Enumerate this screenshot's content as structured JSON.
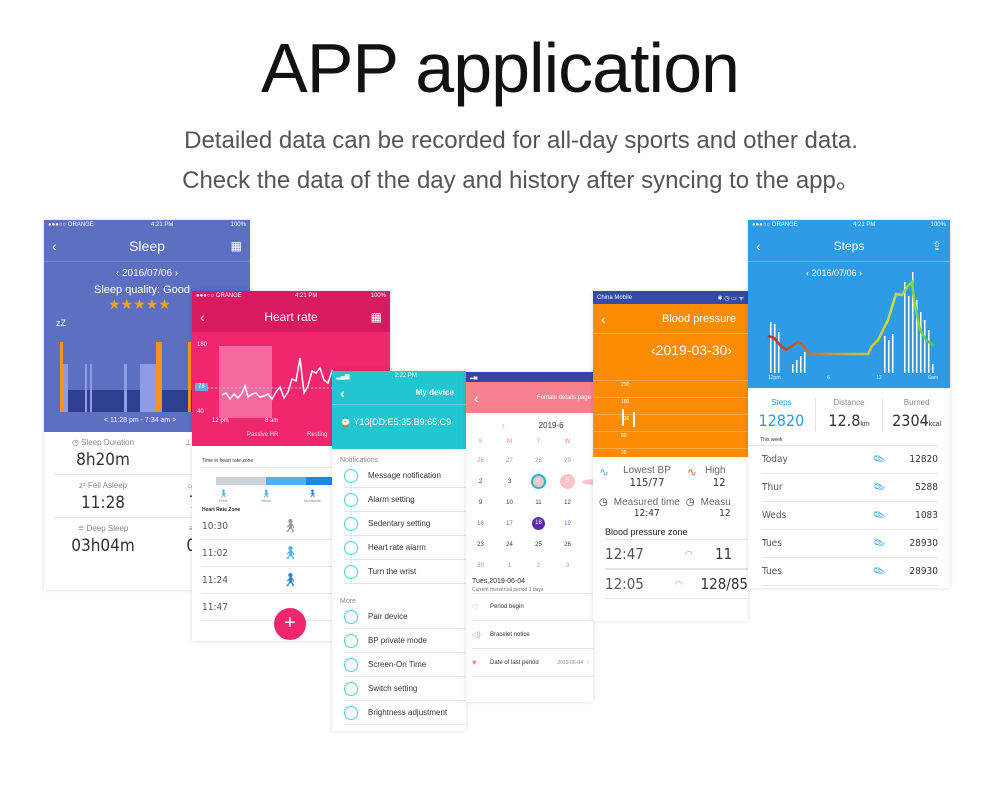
{
  "heading": {
    "title": "APP application",
    "line1": "Detailed data can be recorded for all-day sports and other data.",
    "line2": "Check the data of the day and history after syncing to the app。"
  },
  "colors": {
    "sleep": "#5c6fc0",
    "heart": "#f0266f",
    "device": "#22c6d1",
    "female": "#f7818f",
    "bp": "#fb8c04",
    "steps": "#2d9be6"
  },
  "sleep": {
    "carrier": "●●●○○ ORANGE",
    "time": "4:21 PM",
    "battery": "100%",
    "title": "Sleep",
    "date": "2016/07/06",
    "quality": "Sleep quality: Good",
    "stars": 5,
    "zz": "zZ",
    "range": "< 11:28 pm - 7:34 am >",
    "stats": [
      {
        "label": "Sleep Duration",
        "value": "8h20m"
      },
      {
        "label": "Awake",
        "value": "12"
      },
      {
        "label": "Fell Asleep",
        "value": "11:28"
      },
      {
        "label": "Woke",
        "value": "7:3"
      },
      {
        "label": "Deep Sleep",
        "value": "03h04m"
      },
      {
        "label": "Light",
        "value": "01h"
      }
    ]
  },
  "heart": {
    "carrier": "●●●○○ ORANGE",
    "time": "4:21 PM",
    "battery": "100%",
    "title": "Heart rate",
    "y_top": "180",
    "y_mid": "78",
    "y_bot": "40",
    "x_left": "12 pm",
    "x_right": "8 am",
    "legend1": "Passive HR",
    "legend2": "Resting",
    "zone_title": "Time in heart rate zone",
    "zones": [
      "Rest",
      "Move",
      "Moderate",
      "Maxi"
    ],
    "list_title": "Heart Rate Zone",
    "times": [
      "10:30",
      "11:02",
      "11:24",
      "11:47"
    ],
    "fab": "+"
  },
  "device": {
    "time": "2:22 PM",
    "title": "My device",
    "device_name": "Y13[DD:E5:35:B9:65:C9",
    "section1": "Notifications",
    "notifications": [
      "Message notification",
      "Alarm setting",
      "Sedentary setting",
      "Heart rate alarm",
      "Turn the wrist"
    ],
    "section2": "More",
    "more": [
      "Pair device",
      "BP private mode",
      "Screen-On Time",
      "Switch setting",
      "Brightness adjustment"
    ]
  },
  "female": {
    "title": "Female details page",
    "month": "2019-6",
    "weekdays": [
      "S",
      "M",
      "T",
      "W",
      "T"
    ],
    "weeks": [
      [
        "26",
        "27",
        "28",
        "29",
        "3"
      ],
      [
        "2",
        "3",
        "4",
        "5",
        "6"
      ],
      [
        "9",
        "10",
        "11",
        "12",
        "1"
      ],
      [
        "16",
        "17",
        "18",
        "19",
        "2"
      ],
      [
        "23",
        "24",
        "25",
        "26",
        "2"
      ],
      [
        "30",
        "1",
        "2",
        "3",
        "4"
      ]
    ],
    "selected_date": "Tues,2019-06-04",
    "period_note": "Current menstrual period 1 days",
    "items": [
      "Period begin",
      "Bracelet notice",
      "Date of last period"
    ],
    "last_period": "2019-06-04"
  },
  "bp": {
    "carrier": "China Mobile",
    "title": "Blood pressure",
    "date": "2019-03-30",
    "y_ticks": [
      "230",
      "180",
      "130",
      "80",
      "30"
    ],
    "lowest_label": "Lowest BP",
    "lowest_value": "115/77",
    "highest_label": "High",
    "highest_value": "12",
    "measured_label": "Measured time",
    "measured_value": "12:47",
    "measured2_label": "Measu",
    "measured2_value": "12",
    "zone_title": "Blood pressure zone",
    "rows": [
      {
        "time": "12:47",
        "value": "11"
      },
      {
        "time": "12:05",
        "value": "128/85"
      }
    ]
  },
  "steps": {
    "carrier": "●●●○○ ORANGE",
    "time": "4:21 PM",
    "battery": "100%",
    "title": "Steps",
    "date": "2016/07/06",
    "x_labels": [
      "12pm",
      "6",
      "12",
      "6am"
    ],
    "summary": [
      {
        "label": "Steps",
        "value": "12820",
        "unit": ""
      },
      {
        "label": "Distance",
        "value": "12.8",
        "unit": "km"
      },
      {
        "label": "Burned",
        "value": "2304",
        "unit": "kcal"
      }
    ],
    "week_title": "This week",
    "week": [
      {
        "day": "Today",
        "value": "12820"
      },
      {
        "day": "Thur",
        "value": "5288"
      },
      {
        "day": "Weds",
        "value": "1083"
      },
      {
        "day": "Tues",
        "value": "28930"
      },
      {
        "day": "Tues",
        "value": "28930"
      }
    ]
  }
}
